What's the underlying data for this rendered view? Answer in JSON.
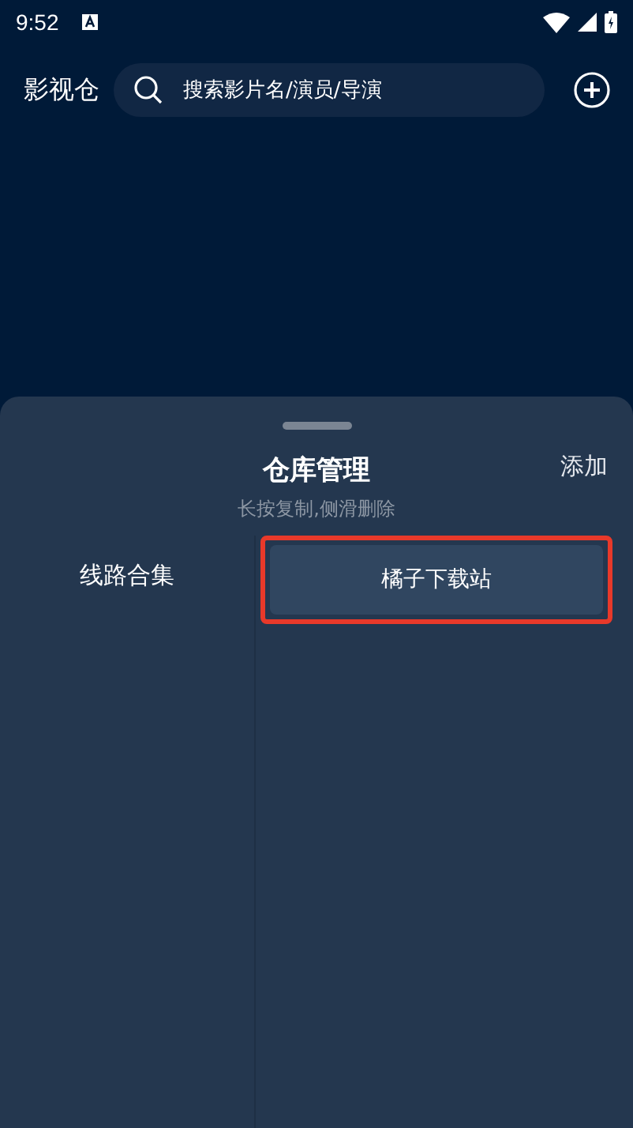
{
  "status_bar": {
    "time": "9:52"
  },
  "header": {
    "title": "影视仓",
    "search": {
      "placeholder": "搜索影片名/演员/导演"
    }
  },
  "sheet": {
    "title": "仓库管理",
    "add_label": "添加",
    "hint": "长按复制,侧滑删除",
    "categories": [
      {
        "label": "线路合集",
        "selected": true
      }
    ],
    "items": [
      {
        "label": "橘子下载站",
        "highlighted": true
      }
    ]
  }
}
